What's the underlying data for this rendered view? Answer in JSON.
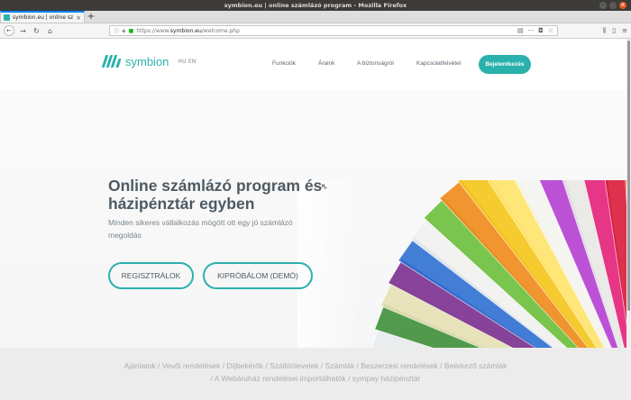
{
  "window": {
    "title": "symbion.eu | online számlázó program - Mozilla Firefox"
  },
  "browser": {
    "tab_title": "symbion.eu | online számlá",
    "url_prefix": "https://www.",
    "url_host": "symbion.eu",
    "url_path": "/welcome.php"
  },
  "site": {
    "logo_text": "symbion",
    "lang": "HU  EN",
    "nav": [
      "Funkciók",
      "Áraink",
      "A biztonságról",
      "Kapcsolatfelvétel"
    ],
    "login": "Bejelentkezés",
    "accent": "#2ab1ad"
  },
  "hero": {
    "title": "Online számlázó program és házipénztár egyben",
    "subtitle": "Minden sikeres vállalkozás mögött ott egy jó számlázó megoldás",
    "btn_register": "REGISZTRÁLOK",
    "btn_demo": "KIPRÓBÁLOM (DEMÓ)"
  },
  "features": {
    "line1": "Ajánlatok / Vevői rendelések / Díjbekérők / Szállítólevelek / Számlák / Beszerzési rendelések / Beérkező számlák",
    "line2": "/ A Webáruház rendelései importálhatók / sympay házipénztár"
  }
}
